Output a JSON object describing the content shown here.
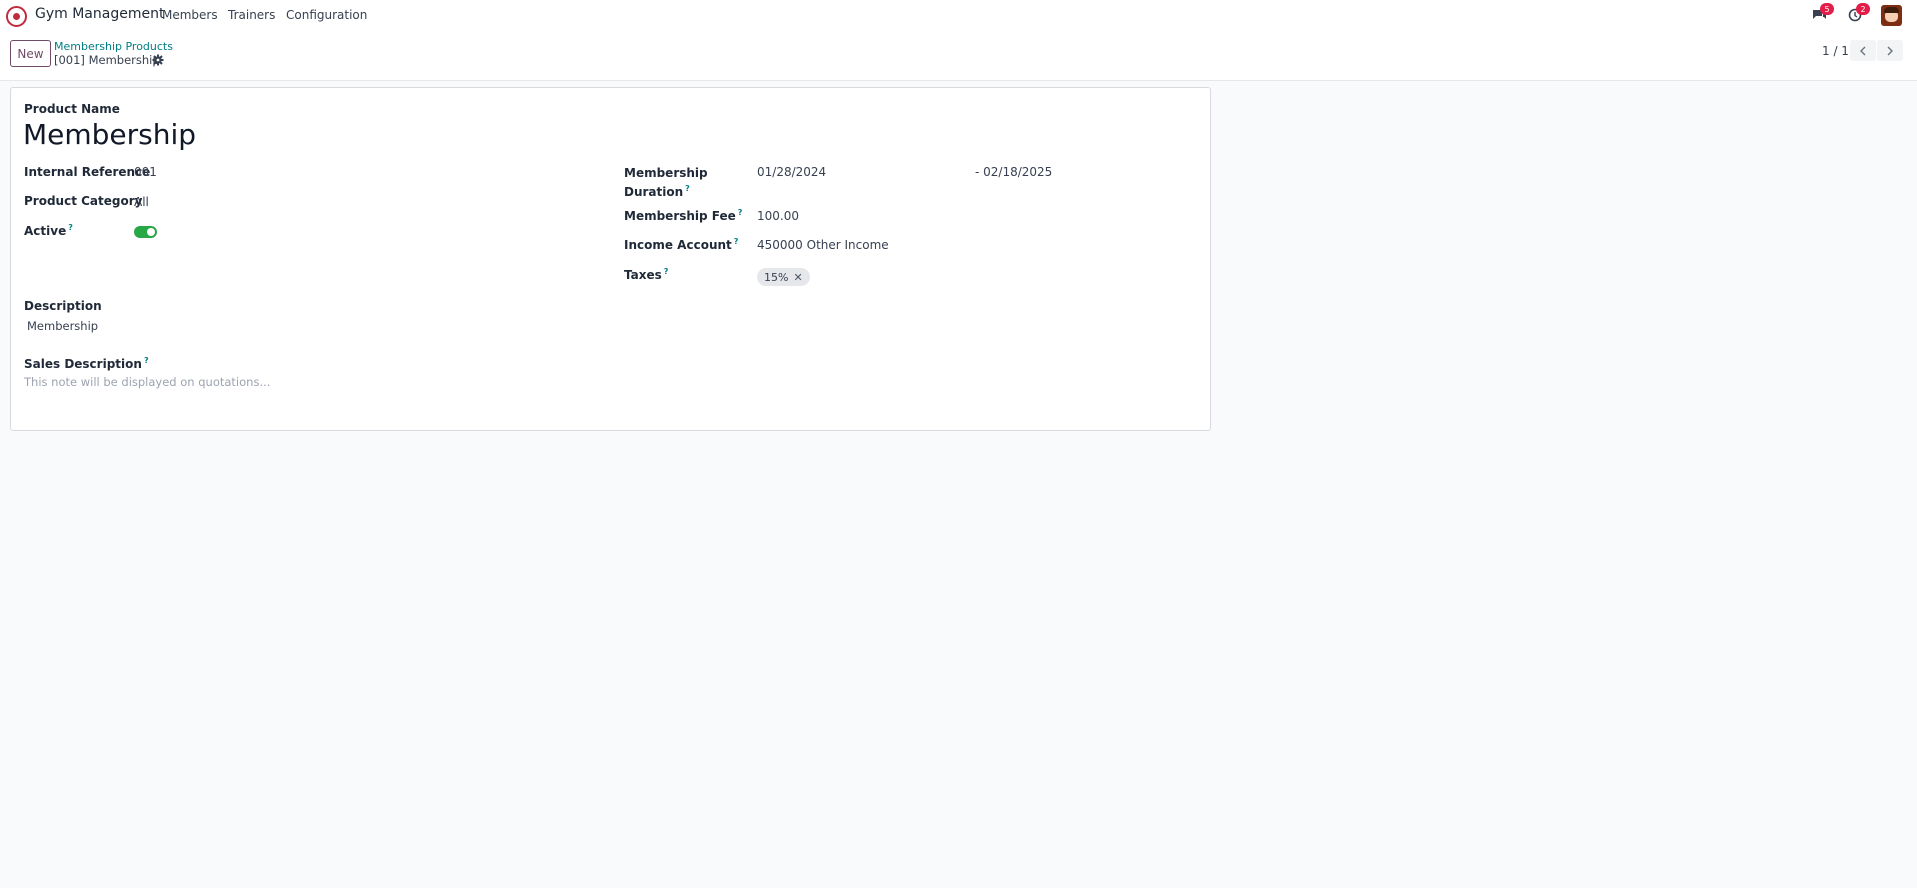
{
  "navbar": {
    "app_name": "Gym Management",
    "menu": [
      "Members",
      "Trainers",
      "Configuration"
    ],
    "chat_badge": "5",
    "activity_badge": "2"
  },
  "control_panel": {
    "new_label": "New",
    "breadcrumb": "Membership Products",
    "record_title": "[001] Membership",
    "pager": "1 / 1"
  },
  "form": {
    "product_name_label": "Product Name",
    "product_name": "Membership",
    "internal_reference_label": "Internal Reference",
    "internal_reference": "001",
    "product_category_label": "Product Category",
    "product_category": "All",
    "active_label": "Active",
    "active": true,
    "membership_duration_label_1": "Membership",
    "membership_duration_label_2": "Duration",
    "date_from": "01/28/2024",
    "date_to": "- 02/18/2025",
    "membership_fee_label": "Membership Fee",
    "membership_fee": "100.00",
    "income_account_label": "Income Account",
    "income_account": "450000 Other Income",
    "taxes_label": "Taxes",
    "tax_tag": "15%",
    "description_label": "Description",
    "description": "Membership",
    "sales_description_label": "Sales Description",
    "sales_description_placeholder": "This note will be displayed on quotations..."
  },
  "colors": {
    "brand": "#714b67",
    "link": "#017e84",
    "toggle_on": "#28a745",
    "badge": "#e11d48"
  }
}
